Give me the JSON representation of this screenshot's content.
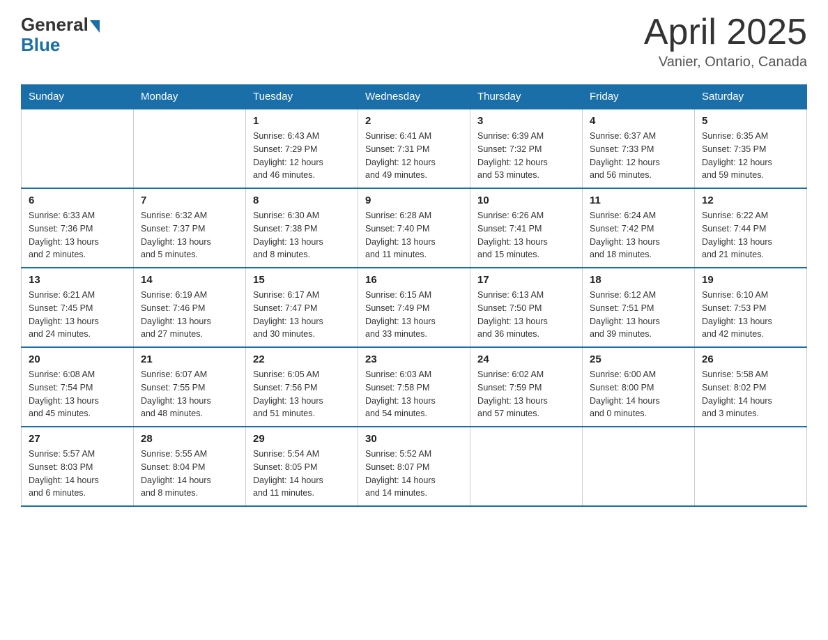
{
  "logo": {
    "general": "General",
    "blue": "Blue"
  },
  "title": "April 2025",
  "location": "Vanier, Ontario, Canada",
  "days_of_week": [
    "Sunday",
    "Monday",
    "Tuesday",
    "Wednesday",
    "Thursday",
    "Friday",
    "Saturday"
  ],
  "weeks": [
    [
      {
        "day": "",
        "info": ""
      },
      {
        "day": "",
        "info": ""
      },
      {
        "day": "1",
        "info": "Sunrise: 6:43 AM\nSunset: 7:29 PM\nDaylight: 12 hours\nand 46 minutes."
      },
      {
        "day": "2",
        "info": "Sunrise: 6:41 AM\nSunset: 7:31 PM\nDaylight: 12 hours\nand 49 minutes."
      },
      {
        "day": "3",
        "info": "Sunrise: 6:39 AM\nSunset: 7:32 PM\nDaylight: 12 hours\nand 53 minutes."
      },
      {
        "day": "4",
        "info": "Sunrise: 6:37 AM\nSunset: 7:33 PM\nDaylight: 12 hours\nand 56 minutes."
      },
      {
        "day": "5",
        "info": "Sunrise: 6:35 AM\nSunset: 7:35 PM\nDaylight: 12 hours\nand 59 minutes."
      }
    ],
    [
      {
        "day": "6",
        "info": "Sunrise: 6:33 AM\nSunset: 7:36 PM\nDaylight: 13 hours\nand 2 minutes."
      },
      {
        "day": "7",
        "info": "Sunrise: 6:32 AM\nSunset: 7:37 PM\nDaylight: 13 hours\nand 5 minutes."
      },
      {
        "day": "8",
        "info": "Sunrise: 6:30 AM\nSunset: 7:38 PM\nDaylight: 13 hours\nand 8 minutes."
      },
      {
        "day": "9",
        "info": "Sunrise: 6:28 AM\nSunset: 7:40 PM\nDaylight: 13 hours\nand 11 minutes."
      },
      {
        "day": "10",
        "info": "Sunrise: 6:26 AM\nSunset: 7:41 PM\nDaylight: 13 hours\nand 15 minutes."
      },
      {
        "day": "11",
        "info": "Sunrise: 6:24 AM\nSunset: 7:42 PM\nDaylight: 13 hours\nand 18 minutes."
      },
      {
        "day": "12",
        "info": "Sunrise: 6:22 AM\nSunset: 7:44 PM\nDaylight: 13 hours\nand 21 minutes."
      }
    ],
    [
      {
        "day": "13",
        "info": "Sunrise: 6:21 AM\nSunset: 7:45 PM\nDaylight: 13 hours\nand 24 minutes."
      },
      {
        "day": "14",
        "info": "Sunrise: 6:19 AM\nSunset: 7:46 PM\nDaylight: 13 hours\nand 27 minutes."
      },
      {
        "day": "15",
        "info": "Sunrise: 6:17 AM\nSunset: 7:47 PM\nDaylight: 13 hours\nand 30 minutes."
      },
      {
        "day": "16",
        "info": "Sunrise: 6:15 AM\nSunset: 7:49 PM\nDaylight: 13 hours\nand 33 minutes."
      },
      {
        "day": "17",
        "info": "Sunrise: 6:13 AM\nSunset: 7:50 PM\nDaylight: 13 hours\nand 36 minutes."
      },
      {
        "day": "18",
        "info": "Sunrise: 6:12 AM\nSunset: 7:51 PM\nDaylight: 13 hours\nand 39 minutes."
      },
      {
        "day": "19",
        "info": "Sunrise: 6:10 AM\nSunset: 7:53 PM\nDaylight: 13 hours\nand 42 minutes."
      }
    ],
    [
      {
        "day": "20",
        "info": "Sunrise: 6:08 AM\nSunset: 7:54 PM\nDaylight: 13 hours\nand 45 minutes."
      },
      {
        "day": "21",
        "info": "Sunrise: 6:07 AM\nSunset: 7:55 PM\nDaylight: 13 hours\nand 48 minutes."
      },
      {
        "day": "22",
        "info": "Sunrise: 6:05 AM\nSunset: 7:56 PM\nDaylight: 13 hours\nand 51 minutes."
      },
      {
        "day": "23",
        "info": "Sunrise: 6:03 AM\nSunset: 7:58 PM\nDaylight: 13 hours\nand 54 minutes."
      },
      {
        "day": "24",
        "info": "Sunrise: 6:02 AM\nSunset: 7:59 PM\nDaylight: 13 hours\nand 57 minutes."
      },
      {
        "day": "25",
        "info": "Sunrise: 6:00 AM\nSunset: 8:00 PM\nDaylight: 14 hours\nand 0 minutes."
      },
      {
        "day": "26",
        "info": "Sunrise: 5:58 AM\nSunset: 8:02 PM\nDaylight: 14 hours\nand 3 minutes."
      }
    ],
    [
      {
        "day": "27",
        "info": "Sunrise: 5:57 AM\nSunset: 8:03 PM\nDaylight: 14 hours\nand 6 minutes."
      },
      {
        "day": "28",
        "info": "Sunrise: 5:55 AM\nSunset: 8:04 PM\nDaylight: 14 hours\nand 8 minutes."
      },
      {
        "day": "29",
        "info": "Sunrise: 5:54 AM\nSunset: 8:05 PM\nDaylight: 14 hours\nand 11 minutes."
      },
      {
        "day": "30",
        "info": "Sunrise: 5:52 AM\nSunset: 8:07 PM\nDaylight: 14 hours\nand 14 minutes."
      },
      {
        "day": "",
        "info": ""
      },
      {
        "day": "",
        "info": ""
      },
      {
        "day": "",
        "info": ""
      }
    ]
  ]
}
